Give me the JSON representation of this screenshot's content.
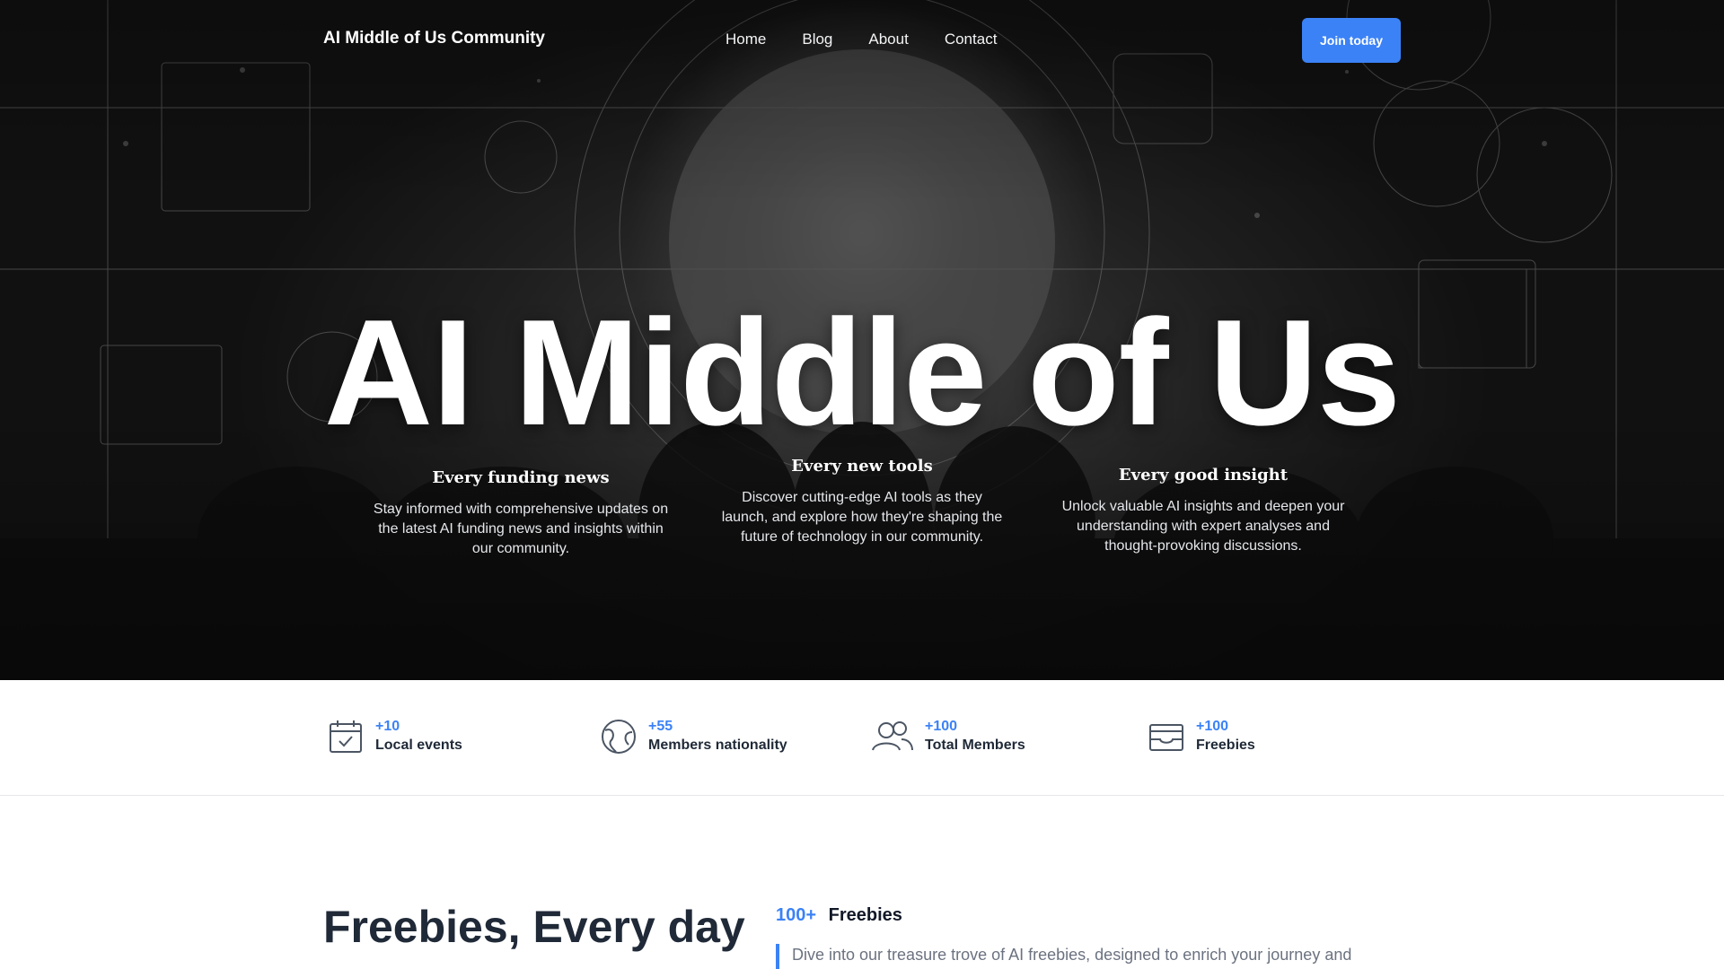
{
  "header": {
    "brand": "AI Middle of Us Community",
    "nav": [
      "Home",
      "Blog",
      "About",
      "Contact"
    ],
    "cta_label": "Join today"
  },
  "hero": {
    "title": "AI Middle of Us",
    "features": [
      {
        "title": "Every funding news",
        "text": "Stay informed with comprehensive updates on the latest AI funding news and insights within our community."
      },
      {
        "title": "Every new tools",
        "text": "Discover cutting-edge AI tools as they launch, and explore how they're shaping the future of technology in our community."
      },
      {
        "title": "Every good insight",
        "text": "Unlock valuable AI insights and deepen your understanding with expert analyses and thought-provoking discussions."
      }
    ]
  },
  "stats": [
    {
      "value": "+10",
      "label": "Local events",
      "icon": "calendar-check-icon"
    },
    {
      "value": "+55",
      "label": "Members nationality",
      "icon": "globe-icon"
    },
    {
      "value": "+100",
      "label": "Total Members",
      "icon": "users-icon"
    },
    {
      "value": "+100",
      "label": "Freebies",
      "icon": "inbox-icon"
    }
  ],
  "freebies": {
    "title": "Freebies, Every day",
    "count": "100+",
    "count_label": "Freebies",
    "description": "Dive into our treasure trove of AI freebies, designed to enrich your journey and"
  },
  "colors": {
    "accent": "#3b82f6",
    "text_dark": "#1f2937",
    "hero_bg": "#2a2a2a"
  }
}
